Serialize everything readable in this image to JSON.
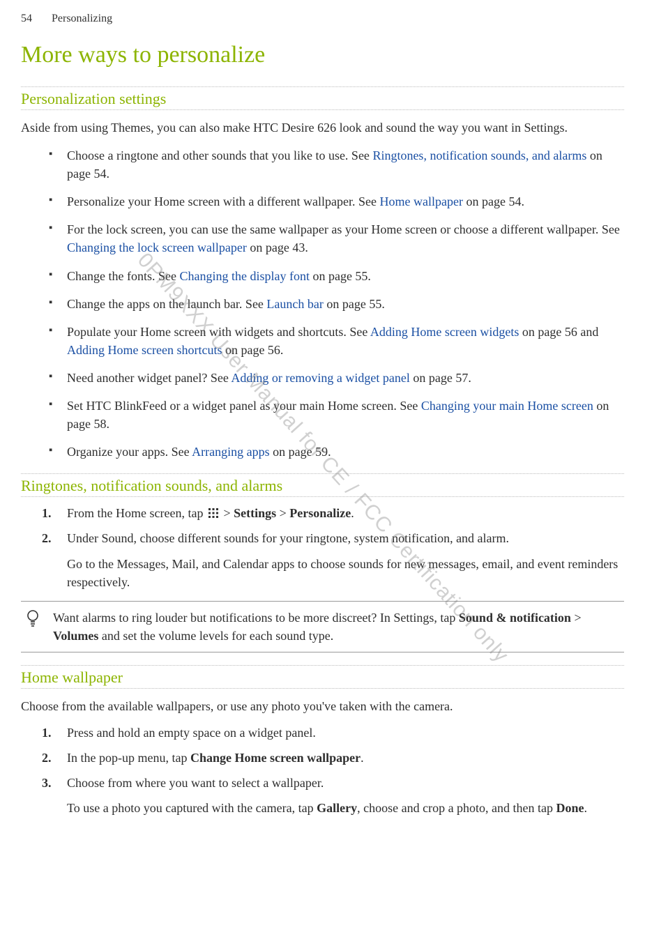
{
  "header": {
    "page_number": "54",
    "section": "Personalizing"
  },
  "title": "More ways to personalize",
  "watermark": "0PM9XXX User Manual for CE / FCC Certification only",
  "s1": {
    "heading": "Personalization settings",
    "intro": "Aside from using Themes, you can also make HTC Desire 626 look and sound the way you want in Settings.",
    "bullets": {
      "b0": {
        "t1": "Choose a ringtone and other sounds that you like to use. See ",
        "link1": "Ringtones, notification sounds, and alarms",
        "t2": " on page 54."
      },
      "b1": {
        "t1": "Personalize your Home screen with a different wallpaper. See ",
        "link1": "Home wallpaper",
        "t2": " on page 54."
      },
      "b2": {
        "t1": "For the lock screen, you can use the same wallpaper as your Home screen or choose a different wallpaper. See ",
        "link1": "Changing the lock screen wallpaper",
        "t2": " on page 43."
      },
      "b3": {
        "t1": "Change the fonts. See ",
        "link1": "Changing the display font",
        "t2": " on page 55."
      },
      "b4": {
        "t1": "Change the apps on the launch bar. See ",
        "link1": "Launch bar",
        "t2": " on page 55."
      },
      "b5": {
        "t1": "Populate your Home screen with widgets and shortcuts. See ",
        "link1": "Adding Home screen widgets",
        "t2": " on page 56 and ",
        "link2": "Adding Home screen shortcuts",
        "t3": " on page 56."
      },
      "b6": {
        "t1": "Need another widget panel? See ",
        "link1": "Adding or removing a widget panel",
        "t2": " on page 57."
      },
      "b7": {
        "t1": "Set HTC BlinkFeed or a widget panel as your main Home screen. See ",
        "link1": "Changing your main Home screen",
        "t2": " on page 58."
      },
      "b8": {
        "t1": "Organize your apps. See ",
        "link1": "Arranging apps",
        "t2": " on page 59."
      }
    }
  },
  "s2": {
    "heading": "Ringtones, notification sounds, and alarms",
    "step1": {
      "pre": "From the Home screen, tap ",
      "gt1": " > ",
      "settings": "Settings",
      "gt2": " > ",
      "personalize": "Personalize",
      "dot": "."
    },
    "step2": {
      "main": "Under Sound, choose different sounds for your ringtone, system notification, and alarm.",
      "sub": "Go to the Messages, Mail, and Calendar apps to choose sounds for new messages, email, and event reminders respectively."
    },
    "tip": {
      "t1": "Want alarms to ring louder but notifications to be more discreet? In Settings, tap ",
      "b1": "Sound & notification",
      "gt": " > ",
      "b2": "Volumes",
      "t2": " and set the volume levels for each sound type."
    }
  },
  "s3": {
    "heading": "Home wallpaper",
    "intro": "Choose from the available wallpapers, or use any photo you've taken with the camera.",
    "steps": {
      "s1": "Press and hold an empty space on a widget panel.",
      "s2": {
        "t1": "In the pop-up menu, tap ",
        "b1": "Change Home screen wallpaper",
        "dot": "."
      },
      "s3": {
        "main": "Choose from where you want to select a wallpaper.",
        "sub": {
          "t1": "To use a photo you captured with the camera, tap ",
          "b1": "Gallery",
          "t2": ", choose and crop a photo, and then tap ",
          "b2": "Done",
          "dot": "."
        }
      }
    }
  }
}
